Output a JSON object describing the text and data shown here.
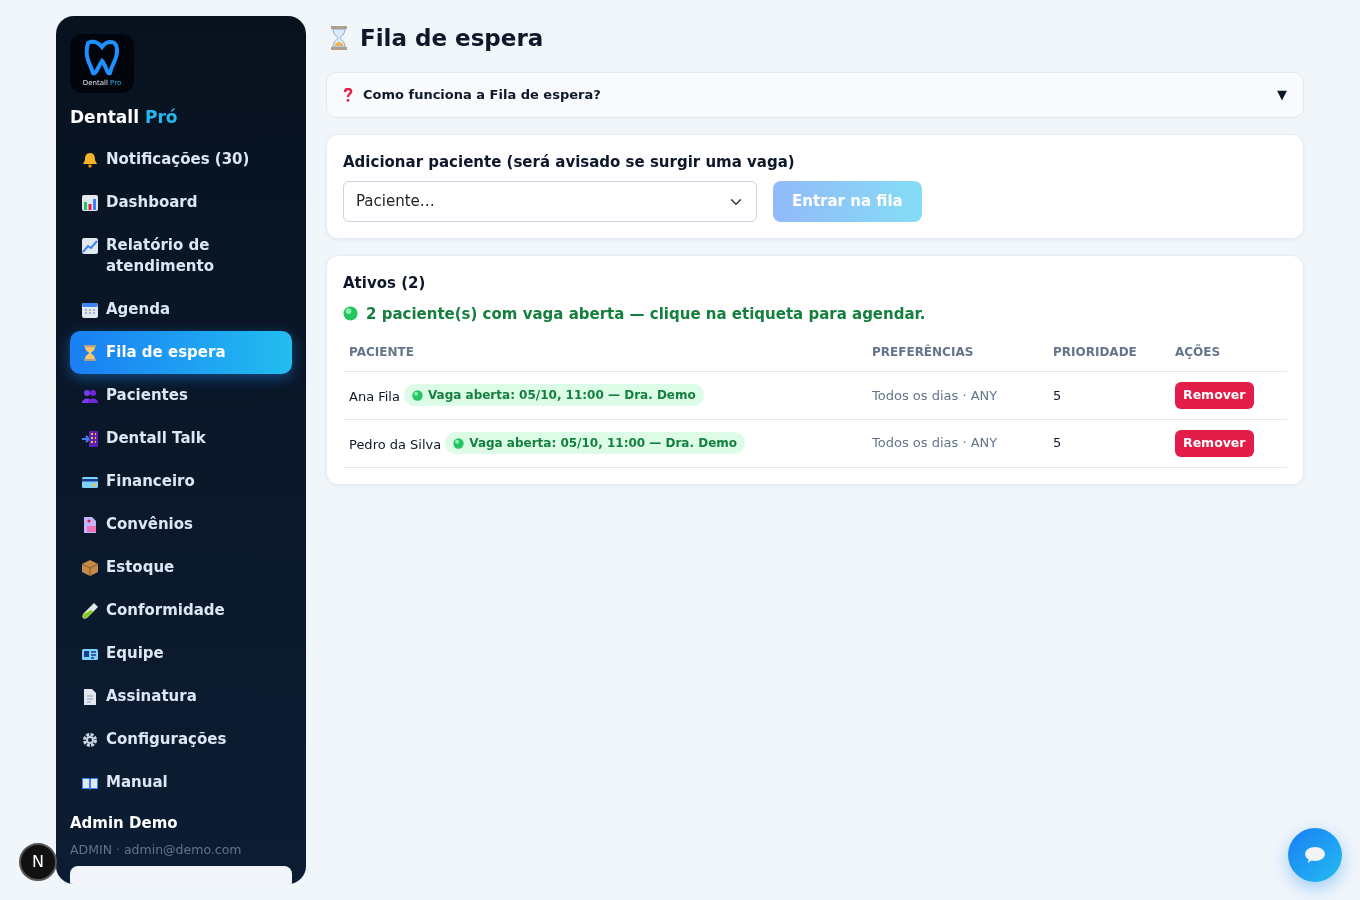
{
  "sidebar": {
    "logo_caption": {
      "name": "Dentall",
      "accent": "Pro"
    },
    "brand": {
      "name": "Dentall",
      "accent": "Pró"
    },
    "items": [
      {
        "label": "Notificações (30)",
        "selected": false
      },
      {
        "label": "Dashboard",
        "selected": false
      },
      {
        "label": "Relatório de atendimento",
        "selected": false
      },
      {
        "label": "Agenda",
        "selected": false
      },
      {
        "label": "Fila de espera",
        "selected": true
      },
      {
        "label": "Pacientes",
        "selected": false
      },
      {
        "label": "Dentall Talk",
        "selected": false
      },
      {
        "label": "Financeiro",
        "selected": false
      },
      {
        "label": "Convênios",
        "selected": false
      },
      {
        "label": "Estoque",
        "selected": false
      },
      {
        "label": "Conformidade",
        "selected": false
      },
      {
        "label": "Equipe",
        "selected": false
      },
      {
        "label": "Assinatura",
        "selected": false
      },
      {
        "label": "Configurações",
        "selected": false
      },
      {
        "label": "Manual",
        "selected": false
      }
    ],
    "user": {
      "name": "Admin Demo",
      "meta": "ADMIN · admin@demo.com"
    }
  },
  "page": {
    "title": "Fila de espera"
  },
  "help": {
    "question": "Como funciona a Fila de espera?",
    "toggle": "▼",
    "expanded": false
  },
  "add_form": {
    "title": "Adicionar paciente (será avisado se surgir uma vaga)",
    "select": {
      "value": "Paciente…"
    },
    "button": {
      "label": "Entrar na fila",
      "disabled": true
    }
  },
  "active": {
    "title": "Ativos (2)",
    "notice": "2 paciente(s) com vaga aberta — clique na etiqueta para agendar.",
    "columns": [
      "PACIENTE",
      "PREFERÊNCIAS",
      "PRIORIDADE",
      "AÇÕES"
    ],
    "rows": [
      {
        "patient": "Ana Fila",
        "tag": "Vaga aberta: 05/10, 11:00 — Dra. Demo",
        "preferences": "Todos os dias · ANY",
        "priority": "5",
        "action": "Remover"
      },
      {
        "patient": "Pedro da Silva",
        "tag": "Vaga aberta: 05/10, 11:00 — Dra. Demo",
        "preferences": "Todos os dias · ANY",
        "priority": "5",
        "action": "Remover"
      }
    ]
  },
  "dev_badge": "N"
}
